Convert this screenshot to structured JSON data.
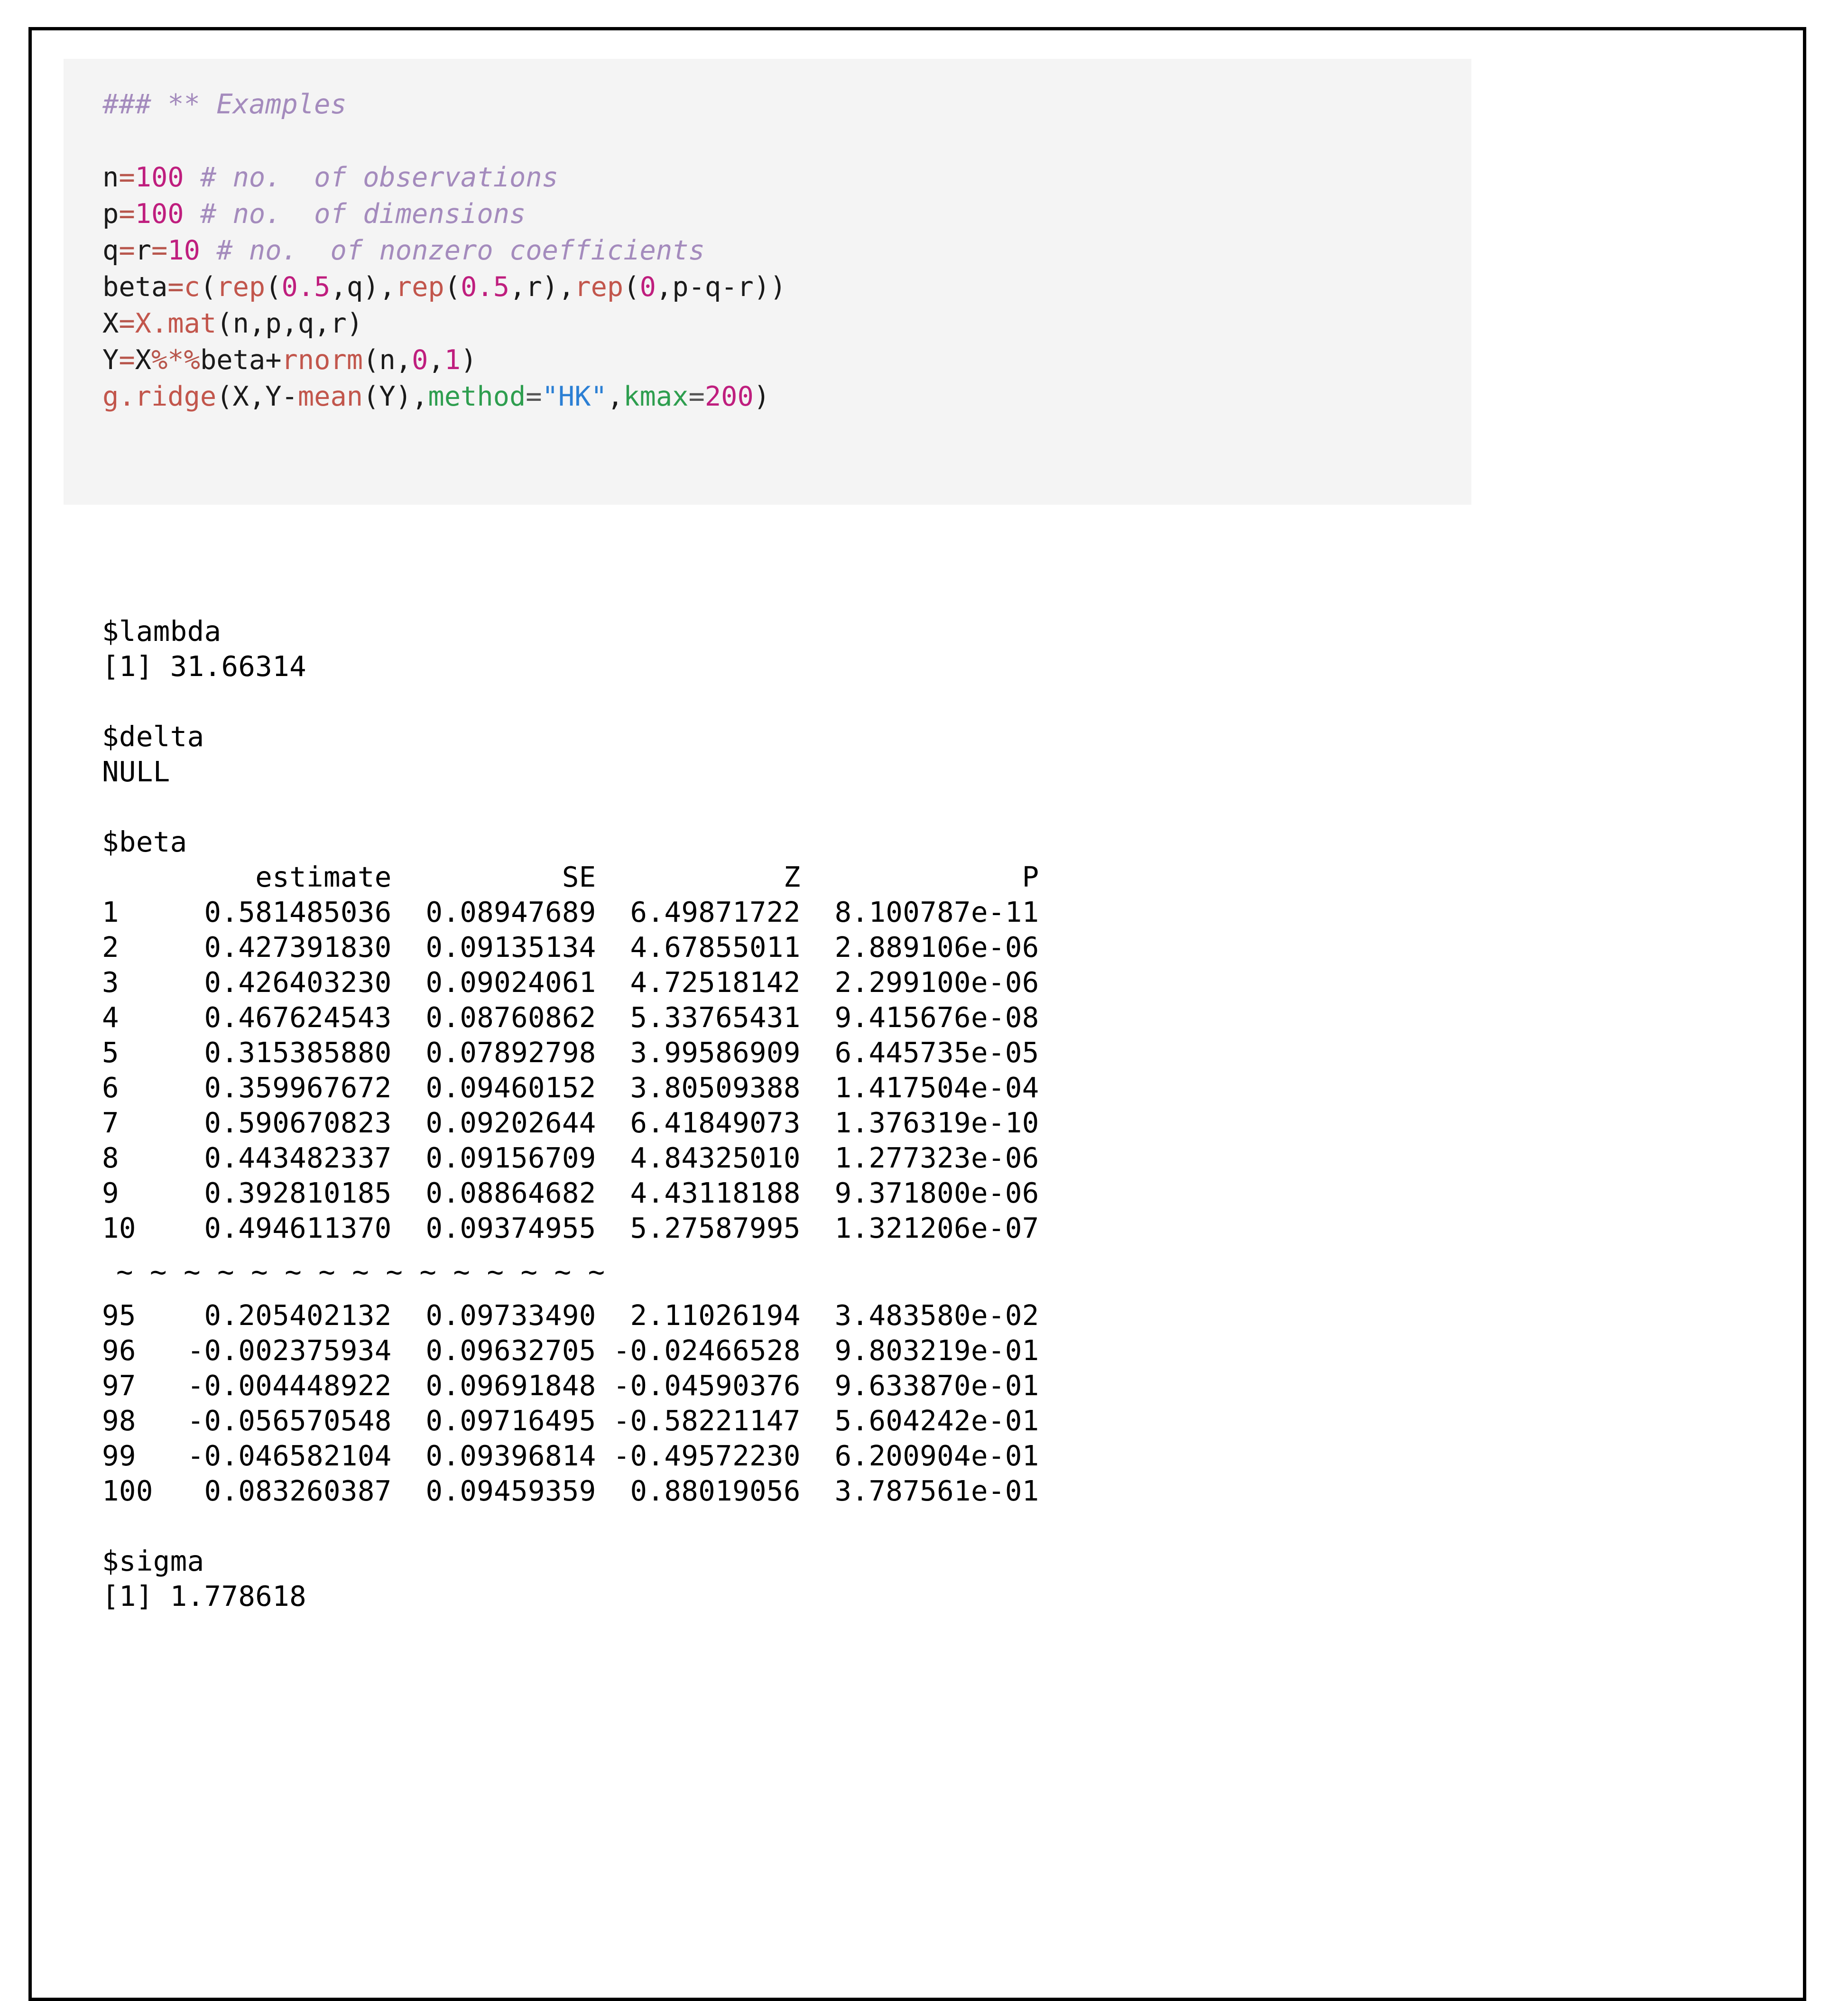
{
  "document": {
    "kind": "r-help-page",
    "border_color": "#000000",
    "background": "#ffffff"
  },
  "code_block": {
    "background": "#f4f4f4",
    "colors": {
      "comment": "#a48bbd",
      "number": "#bf1e7e",
      "function": "#c2564c",
      "operator": "#b8564c",
      "argument": "#2e9e4f",
      "string": "#2b7fd4",
      "variable": "#1a1a1a"
    },
    "heading": "### ** Examples",
    "lines": [
      {
        "id": "blank-1",
        "tokens": []
      },
      {
        "id": "line-n",
        "tokens": [
          {
            "t": "n",
            "c": "var"
          },
          {
            "t": "=",
            "c": "op"
          },
          {
            "t": "100",
            "c": "num"
          },
          {
            "t": " ",
            "c": "var"
          },
          {
            "t": "# no.  of observations",
            "c": "cmt"
          }
        ]
      },
      {
        "id": "line-p",
        "tokens": [
          {
            "t": "p",
            "c": "var"
          },
          {
            "t": "=",
            "c": "op"
          },
          {
            "t": "100",
            "c": "num"
          },
          {
            "t": " ",
            "c": "var"
          },
          {
            "t": "# no.  of dimensions",
            "c": "cmt"
          }
        ]
      },
      {
        "id": "line-qr",
        "tokens": [
          {
            "t": "q",
            "c": "var"
          },
          {
            "t": "=",
            "c": "op"
          },
          {
            "t": "r",
            "c": "var"
          },
          {
            "t": "=",
            "c": "op"
          },
          {
            "t": "10",
            "c": "num"
          },
          {
            "t": " ",
            "c": "var"
          },
          {
            "t": "# no.  of nonzero coefficients",
            "c": "cmt"
          }
        ]
      },
      {
        "id": "line-beta",
        "tokens": [
          {
            "t": "beta",
            "c": "var"
          },
          {
            "t": "=",
            "c": "op"
          },
          {
            "t": "c",
            "c": "fn"
          },
          {
            "t": "(",
            "c": "paren"
          },
          {
            "t": "rep",
            "c": "fn"
          },
          {
            "t": "(",
            "c": "paren"
          },
          {
            "t": "0.5",
            "c": "num"
          },
          {
            "t": ",q",
            "c": "var"
          },
          {
            "t": "),",
            "c": "paren"
          },
          {
            "t": "rep",
            "c": "fn"
          },
          {
            "t": "(",
            "c": "paren"
          },
          {
            "t": "0.5",
            "c": "num"
          },
          {
            "t": ",r",
            "c": "var"
          },
          {
            "t": "),",
            "c": "paren"
          },
          {
            "t": "rep",
            "c": "fn"
          },
          {
            "t": "(",
            "c": "paren"
          },
          {
            "t": "0",
            "c": "num"
          },
          {
            "t": ",p-q-r",
            "c": "var"
          },
          {
            "t": "))",
            "c": "paren"
          }
        ]
      },
      {
        "id": "line-X",
        "tokens": [
          {
            "t": "X",
            "c": "var"
          },
          {
            "t": "=",
            "c": "op"
          },
          {
            "t": "X.mat",
            "c": "fn"
          },
          {
            "t": "(n,p,q,r)",
            "c": "var"
          }
        ]
      },
      {
        "id": "line-Y",
        "tokens": [
          {
            "t": "Y",
            "c": "var"
          },
          {
            "t": "=",
            "c": "op"
          },
          {
            "t": "X",
            "c": "var"
          },
          {
            "t": "%*%",
            "c": "op"
          },
          {
            "t": "beta+",
            "c": "var"
          },
          {
            "t": "rnorm",
            "c": "fn"
          },
          {
            "t": "(n,",
            "c": "var"
          },
          {
            "t": "0",
            "c": "num"
          },
          {
            "t": ",",
            "c": "var"
          },
          {
            "t": "1",
            "c": "num"
          },
          {
            "t": ")",
            "c": "var"
          }
        ]
      },
      {
        "id": "line-call",
        "tokens": [
          {
            "t": "g.ridge",
            "c": "fn"
          },
          {
            "t": "(X,Y-",
            "c": "var"
          },
          {
            "t": "mean",
            "c": "fn"
          },
          {
            "t": "(Y),",
            "c": "var"
          },
          {
            "t": "method",
            "c": "arg"
          },
          {
            "t": "=",
            "c": "opdark"
          },
          {
            "t": "\"HK\"",
            "c": "str"
          },
          {
            "t": ",",
            "c": "var"
          },
          {
            "t": "kmax",
            "c": "arg"
          },
          {
            "t": "=",
            "c": "opdark"
          },
          {
            "t": "200",
            "c": "num"
          },
          {
            "t": ")",
            "c": "var"
          }
        ]
      }
    ],
    "plain_text": [
      "### ** Examples",
      "",
      "n=100 # no.  of observations",
      "p=100 # no.  of dimensions",
      "q=r=10 # no.  of nonzero coefficients",
      "beta=c(rep(0.5,q),rep(0.5,r),rep(0,p-q-r))",
      "X=X.mat(n,p,q,r)",
      "Y=X%*%beta+rnorm(n,0,1)",
      "g.ridge(X,Y-mean(Y),method=\"HK\",kmax=200)"
    ]
  },
  "output": {
    "lambda": {
      "name": "$lambda",
      "index": "[1]",
      "value": "31.66314",
      "line": "[1] 31.66314"
    },
    "delta": {
      "name": "$delta",
      "value": "NULL"
    },
    "beta": {
      "name": "$beta",
      "columns": [
        "",
        "estimate",
        "SE",
        "Z",
        "P"
      ],
      "header_line": "        estimate          SE           Z            P",
      "rows": [
        {
          "row": "1",
          "estimate": "0.581485036",
          "SE": "0.08947689",
          "Z": "6.49871722",
          "P": "8.100787e-11"
        },
        {
          "row": "2",
          "estimate": "0.427391830",
          "SE": "0.09135134",
          "Z": "4.67855011",
          "P": "2.889106e-06"
        },
        {
          "row": "3",
          "estimate": "0.426403230",
          "SE": "0.09024061",
          "Z": "4.72518142",
          "P": "2.299100e-06"
        },
        {
          "row": "4",
          "estimate": "0.467624543",
          "SE": "0.08760862",
          "Z": "5.33765431",
          "P": "9.415676e-08"
        },
        {
          "row": "5",
          "estimate": "0.315385880",
          "SE": "0.07892798",
          "Z": "3.99586909",
          "P": "6.445735e-05"
        },
        {
          "row": "6",
          "estimate": "0.359967672",
          "SE": "0.09460152",
          "Z": "3.80509388",
          "P": "1.417504e-04"
        },
        {
          "row": "7",
          "estimate": "0.590670823",
          "SE": "0.09202644",
          "Z": "6.41849073",
          "P": "1.376319e-10"
        },
        {
          "row": "8",
          "estimate": "0.443482337",
          "SE": "0.09156709",
          "Z": "4.84325010",
          "P": "1.277323e-06"
        },
        {
          "row": "9",
          "estimate": "0.392810185",
          "SE": "0.08864682",
          "Z": "4.43118188",
          "P": "9.371800e-06"
        },
        {
          "row": "10",
          "estimate": "0.494611370",
          "SE": "0.09374955",
          "Z": "5.27587995",
          "P": "1.321206e-07"
        }
      ],
      "separator": "~ ~ ~ ~ ~ ~ ~ ~ ~ ~ ~ ~ ~ ~ ~",
      "rows_tail": [
        {
          "row": "95",
          "estimate": "0.205402132",
          "SE": "0.09733490",
          "Z": "2.11026194",
          "P": "3.483580e-02"
        },
        {
          "row": "96",
          "estimate": "-0.002375934",
          "SE": "0.09632705",
          "Z": "-0.02466528",
          "P": "9.803219e-01"
        },
        {
          "row": "97",
          "estimate": "-0.004448922",
          "SE": "0.09691848",
          "Z": "-0.04590376",
          "P": "9.633870e-01"
        },
        {
          "row": "98",
          "estimate": "-0.056570548",
          "SE": "0.09716495",
          "Z": "-0.58221147",
          "P": "5.604242e-01"
        },
        {
          "row": "99",
          "estimate": "-0.046582104",
          "SE": "0.09396814",
          "Z": "-0.49572230",
          "P": "6.200904e-01"
        },
        {
          "row": "100",
          "estimate": "0.083260387",
          "SE": "0.09459359",
          "Z": "0.88019056",
          "P": "3.787561e-01"
        }
      ]
    },
    "sigma": {
      "name": "$sigma",
      "index": "[1]",
      "value": "1.778618",
      "line": "[1] 1.778618"
    }
  }
}
